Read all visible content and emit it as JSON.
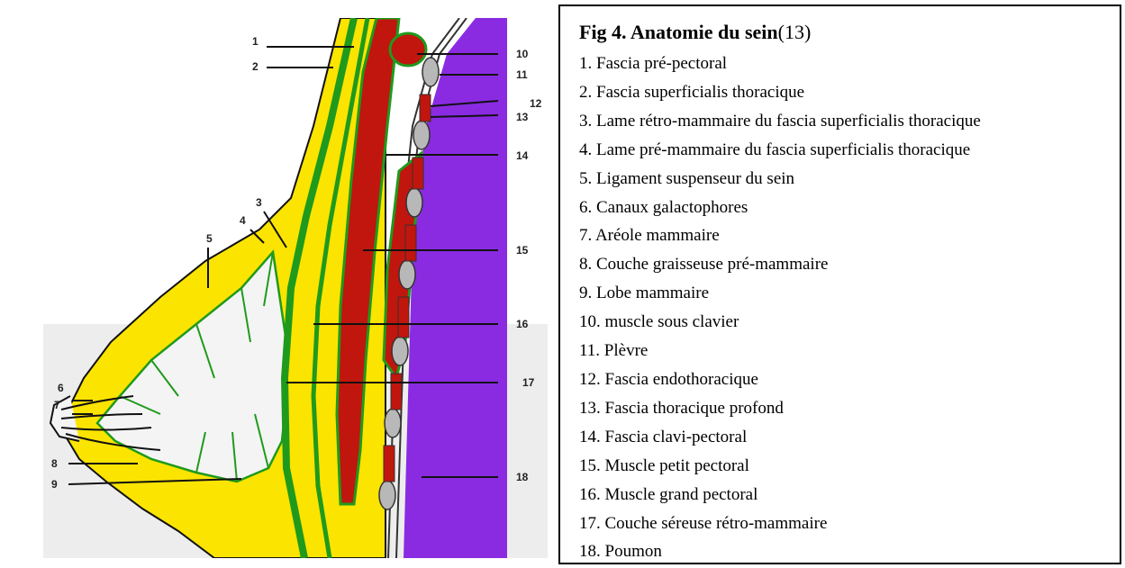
{
  "figure": {
    "title_bold": "Fig 4. Anatomie du sein",
    "title_ref": "(13)",
    "callout_numbers": [
      "1",
      "2",
      "3",
      "4",
      "5",
      "6",
      "7",
      "8",
      "9",
      "10",
      "11",
      "12",
      "13",
      "14",
      "15",
      "16",
      "17",
      "18"
    ],
    "colors": {
      "fat": "#fbe400",
      "fascia": "#1f9a1c",
      "muscle": "#c0160e",
      "bone": "#b8b8b8",
      "lung": "#8a2be2",
      "gland": "#f4f4f4"
    },
    "legend": [
      {
        "num": "1.",
        "text": "Fascia pré-pectoral"
      },
      {
        "num": "2.",
        "text": "Fascia superficialis thoracique"
      },
      {
        "num": "3.",
        "text": "Lame rétro-mammaire du fascia superficialis thoracique"
      },
      {
        "num": "4.",
        "text": "Lame pré-mammaire du fascia superficialis thoracique"
      },
      {
        "num": "5.",
        "text": "Ligament suspenseur du sein"
      },
      {
        "num": "6.",
        "text": "Canaux galactophores"
      },
      {
        "num": "7.",
        "text": "Aréole mammaire"
      },
      {
        "num": "8.",
        "text": "Couche graisseuse pré-mammaire"
      },
      {
        "num": "9.",
        "text": "Lobe mammaire"
      },
      {
        "num": "10.",
        "text": "muscle sous clavier"
      },
      {
        "num": "11.",
        "text": "Plèvre"
      },
      {
        "num": "12.",
        "text": "Fascia endothoracique"
      },
      {
        "num": "13.",
        "text": "Fascia thoracique profond"
      },
      {
        "num": "14.",
        "text": "Fascia clavi-pectoral"
      },
      {
        "num": "15.",
        "text": "Muscle petit pectoral"
      },
      {
        "num": "16.",
        "text": "Muscle grand pectoral"
      },
      {
        "num": "17.",
        "text": "Couche séreuse rétro-mammaire"
      },
      {
        "num": "18.",
        "text": "Poumon"
      }
    ]
  }
}
